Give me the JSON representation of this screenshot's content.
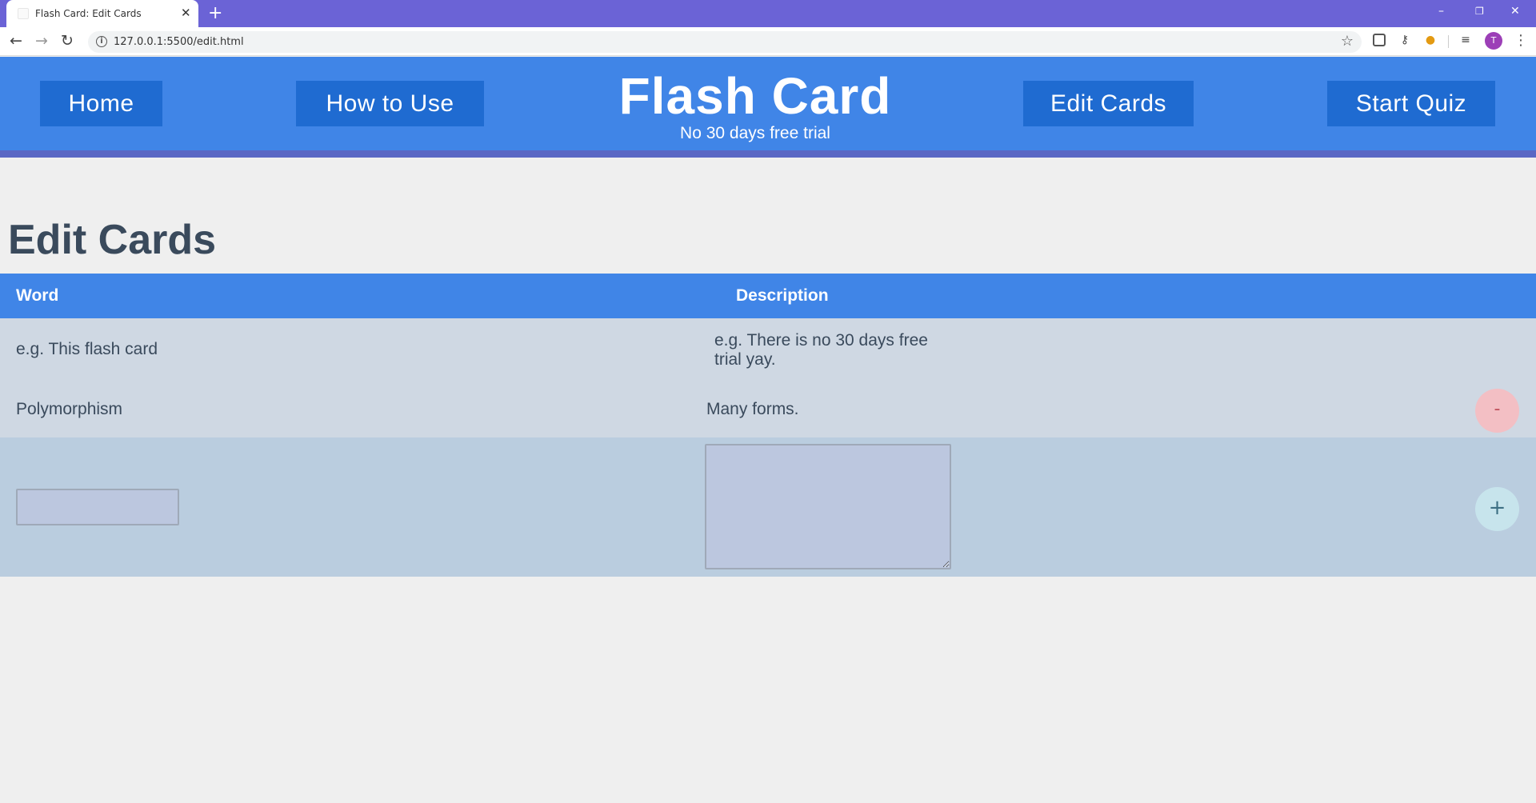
{
  "browser": {
    "tab_title": "Flash Card: Edit Cards",
    "tab_close": "✕",
    "new_tab": "+",
    "url": "127.0.0.1:5500/edit.html",
    "profile_initial": "T",
    "window_controls": {
      "minimize": "–",
      "restore": "❐",
      "close": "✕"
    }
  },
  "header": {
    "nav": {
      "home": "Home",
      "how_to_use": "How to Use",
      "edit_cards": "Edit Cards",
      "start_quiz": "Start Quiz"
    },
    "title": "Flash Card",
    "subtitle": "No 30 days free trial",
    "colors": {
      "header_bg": "#4085e7",
      "button_bg": "#1f6bd1",
      "shadow": "#5a67c4"
    }
  },
  "main": {
    "title": "Edit Cards",
    "table": {
      "columns": [
        "Word",
        "Description"
      ],
      "rows": [
        {
          "word": "e.g. This flash card",
          "description_lines": [
            "e.g. There is no 30 days free",
            "trial yay."
          ]
        },
        {
          "word": "Polymorphism",
          "description": "Many forms.",
          "remove_label": "-"
        }
      ],
      "add_label": "+"
    }
  }
}
